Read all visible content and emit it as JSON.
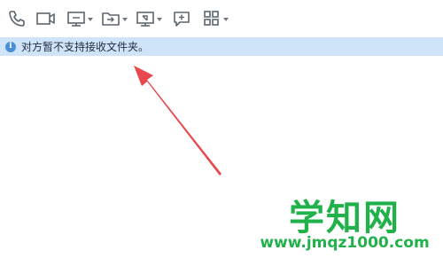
{
  "toolbar": {
    "items": [
      {
        "icon": "phone-icon"
      },
      {
        "icon": "video-call-icon"
      },
      {
        "icon": "screen-share-icon",
        "dropdown": true
      },
      {
        "icon": "file-transfer-icon",
        "dropdown": true
      },
      {
        "icon": "remote-assist-icon",
        "dropdown": true
      },
      {
        "icon": "add-chat-icon"
      },
      {
        "icon": "apps-grid-icon",
        "dropdown": true
      }
    ]
  },
  "notice": {
    "icon": "info-icon",
    "text": "对方暂不支持接收文件夹。"
  },
  "watermark": {
    "title": "学知网",
    "url": "www.jmqz1000.com"
  },
  "colors": {
    "notice_bg": "#cfe4f8",
    "info_icon": "#4a8fd6",
    "arrow": "#e8474b",
    "watermark": "#21b14b"
  }
}
